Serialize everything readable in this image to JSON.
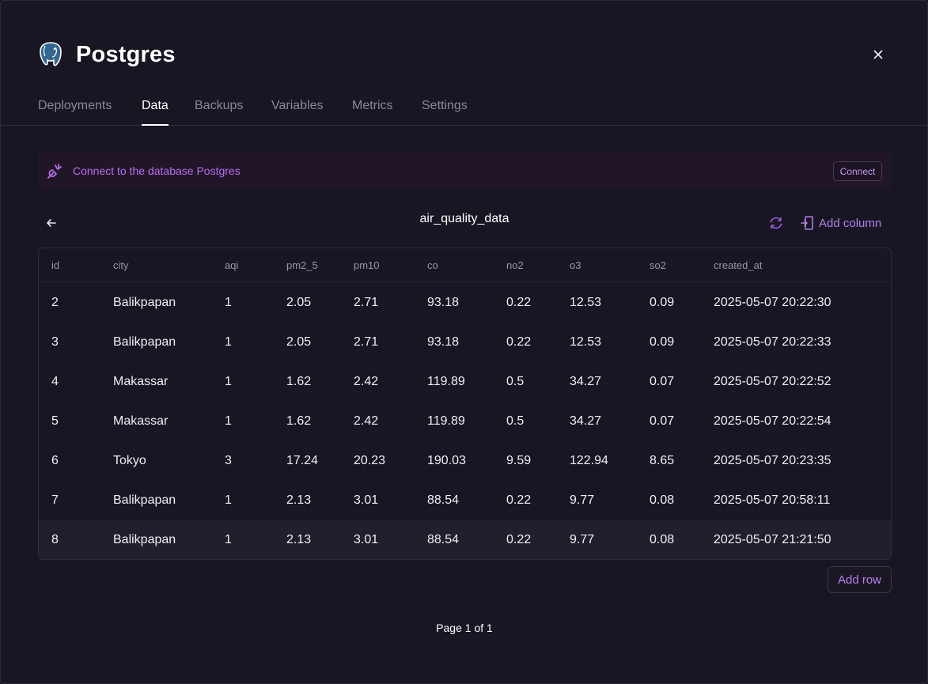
{
  "app": {
    "title": "Postgres",
    "logo_icon": "postgres-elephant-icon",
    "close_icon": "close-icon"
  },
  "tabs": [
    {
      "label": "Deployments",
      "active": false
    },
    {
      "label": "Data",
      "active": true
    },
    {
      "label": "Backups",
      "active": false
    },
    {
      "label": "Variables",
      "active": false
    },
    {
      "label": "Metrics",
      "active": false
    },
    {
      "label": "Settings",
      "active": false
    }
  ],
  "banner": {
    "text": "Connect to the database Postgres",
    "button_label": "Connect",
    "icon": "connect-plug-icon"
  },
  "table_view": {
    "table_name": "air_quality_data",
    "back_icon": "arrow-left-icon",
    "refresh_icon": "refresh-icon",
    "add_column_label": "Add column",
    "add_row_label": "Add row",
    "pagination": "Page 1 of 1"
  },
  "columns": [
    "id",
    "city",
    "aqi",
    "pm2_5",
    "pm10",
    "co",
    "no2",
    "o3",
    "so2",
    "created_at"
  ],
  "rows": [
    [
      "2",
      "Balikpapan",
      "1",
      "2.05",
      "2.71",
      "93.18",
      "0.22",
      "12.53",
      "0.09",
      "2025-05-07 20:22:30"
    ],
    [
      "3",
      "Balikpapan",
      "1",
      "2.05",
      "2.71",
      "93.18",
      "0.22",
      "12.53",
      "0.09",
      "2025-05-07 20:22:33"
    ],
    [
      "4",
      "Makassar",
      "1",
      "1.62",
      "2.42",
      "119.89",
      "0.5",
      "34.27",
      "0.07",
      "2025-05-07 20:22:52"
    ],
    [
      "5",
      "Makassar",
      "1",
      "1.62",
      "2.42",
      "119.89",
      "0.5",
      "34.27",
      "0.07",
      "2025-05-07 20:22:54"
    ],
    [
      "6",
      "Tokyo",
      "3",
      "17.24",
      "20.23",
      "190.03",
      "9.59",
      "122.94",
      "8.65",
      "2025-05-07 20:23:35"
    ],
    [
      "7",
      "Balikpapan",
      "1",
      "2.13",
      "3.01",
      "88.54",
      "0.22",
      "9.77",
      "0.08",
      "2025-05-07 20:58:11"
    ],
    [
      "8",
      "Balikpapan",
      "1",
      "2.13",
      "3.01",
      "88.54",
      "0.22",
      "9.77",
      "0.08",
      "2025-05-07 21:21:50"
    ]
  ],
  "colors": {
    "accent": "#b57ff2",
    "background": "#181622",
    "banner_bg": "#211627"
  }
}
